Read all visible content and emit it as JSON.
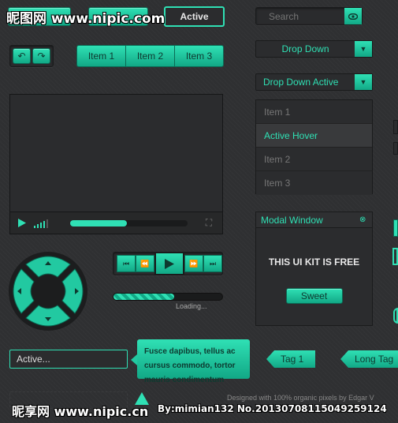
{
  "watermark_top": "昵图网 www.nipic.com",
  "watermark_bottom": "昵享网 www.nipic.cn",
  "watermark_id": "By:mimian132 No.20130708115049259124",
  "buttons": {
    "active_label": "Active"
  },
  "search": {
    "placeholder": "Search"
  },
  "breadcrumb": [
    "Item 1",
    "Item 2",
    "Item 3"
  ],
  "dropdown": {
    "label": "Drop Down",
    "active_label": "Drop Down Active"
  },
  "menu": [
    "Item 1",
    "Active Hover",
    "Item 2",
    "Item 3"
  ],
  "modal": {
    "title": "Modal Window",
    "body": "THIS UI KIT IS FREE",
    "button": "Sweet"
  },
  "player": {
    "loading": "Loading..."
  },
  "input": {
    "value": "Active..."
  },
  "tooltip": {
    "text": "Fusce dapibus, tellus ac cursus commodo, tortor mauris condimentum"
  },
  "tags": [
    "Tag 1",
    "Long Tag"
  ],
  "footer": {
    "credit": "Designed with 100% organic pixels by Edgar V"
  },
  "colors": {
    "accent": "#2fe0b4",
    "accent_dark": "#12a886",
    "bg": "#2f3032"
  }
}
